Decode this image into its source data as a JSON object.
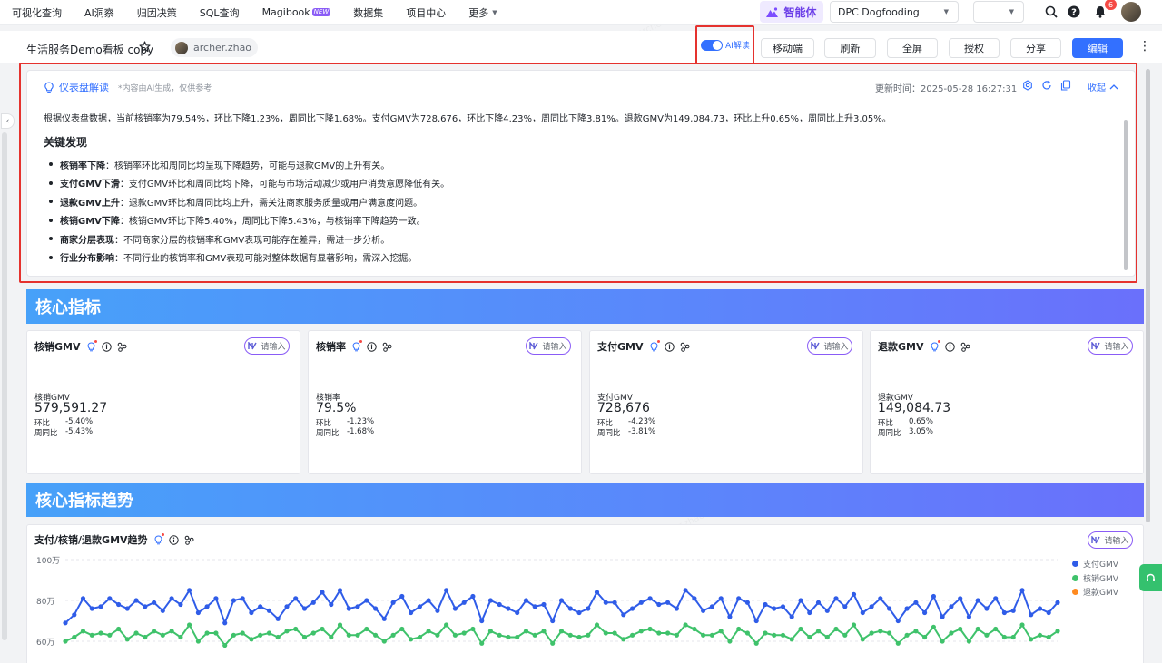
{
  "nav": {
    "items": [
      "可视化查询",
      "AI洞察",
      "归因决策",
      "SQL查询",
      "Magibook",
      "数据集",
      "项目中心",
      "更多"
    ],
    "new_badge": "NEW",
    "agent_label": "智能体",
    "workspace": "DPC Dogfooding",
    "notification_count": "6"
  },
  "dashboard": {
    "title": "生活服务Demo看板 copy",
    "owner": "archer.zhao",
    "ai_toggle_label": "AI解读",
    "buttons": {
      "mobile": "移动端",
      "refresh": "刷新",
      "fullscreen": "全屏",
      "authorize": "授权",
      "share": "分享",
      "edit": "编辑"
    }
  },
  "ai_panel": {
    "title": "仪表盘解读",
    "note": "*内容由AI生成，仅供参考",
    "updated": "更新时间：2025-05-28 16:27:31",
    "collapse_label": "收起",
    "summary": "根据仪表盘数据，当前核销率为79.54%，环比下降1.23%，周同比下降1.68%。支付GMV为728,676，环比下降4.23%，周同比下降3.81%。退款GMV为149,084.73，环比上升0.65%，周同比上升3.05%。",
    "heading": "关键发现",
    "findings": [
      {
        "title": "核销率下降",
        "text": "核销率环比和周同比均呈现下降趋势，可能与退款GMV的上升有关。"
      },
      {
        "title": "支付GMV下滑",
        "text": "支付GMV环比和周同比均下降，可能与市场活动减少或用户消费意愿降低有关。"
      },
      {
        "title": "退款GMV上升",
        "text": "退款GMV环比和周同比均上升，需关注商家服务质量或用户满意度问题。"
      },
      {
        "title": "核销GMV下降",
        "text": "核销GMV环比下降5.40%，周同比下降5.43%，与核销率下降趋势一致。"
      },
      {
        "title": "商家分层表现",
        "text": "不同商家分层的核销率和GMV表现可能存在差异，需进一步分析。"
      },
      {
        "title": "行业分布影响",
        "text": "不同行业的核销率和GMV表现可能对整体数据有显著影响，需深入挖掘。"
      }
    ]
  },
  "sections": {
    "core_metrics": "核心指标",
    "core_trend": "核心指标趋势"
  },
  "ask_label": "请输入",
  "kpis": [
    {
      "title": "核销GMV",
      "label": "核销GMV",
      "value": "579,591.27",
      "mom_label": "环比",
      "mom": "-5.40%",
      "wow_label": "周同比",
      "wow": "-5.43%"
    },
    {
      "title": "核销率",
      "label": "核销率",
      "value": "79.5%",
      "mom_label": "环比",
      "mom": "-1.23%",
      "wow_label": "周同比",
      "wow": "-1.68%"
    },
    {
      "title": "支付GMV",
      "label": "支付GMV",
      "value": "728,676",
      "mom_label": "环比",
      "mom": "-4.23%",
      "wow_label": "周同比",
      "wow": "-3.81%"
    },
    {
      "title": "退款GMV",
      "label": "退款GMV",
      "value": "149,084.73",
      "mom_label": "环比",
      "mom": "0.65%",
      "wow_label": "周同比",
      "wow": "3.05%"
    }
  ],
  "trend": {
    "title": "支付/核销/退款GMV趋势",
    "y_ticks": [
      "100万",
      "80万",
      "60万"
    ]
  },
  "colors": {
    "primary": "#3370ff",
    "pay": "#2f5ce8",
    "verify": "#3fc26b",
    "refund": "#ff8a1f",
    "highlight": "#e5322e"
  },
  "chart_data": {
    "type": "line",
    "ylim": [
      600000,
      1000000
    ],
    "y_ticks": [
      1000000,
      800000,
      600000
    ],
    "series": [
      {
        "name": "支付GMV",
        "values": [
          690000,
          730000,
          810000,
          760000,
          770000,
          810000,
          780000,
          760000,
          800000,
          770000,
          790000,
          750000,
          810000,
          780000,
          850000,
          740000,
          770000,
          810000,
          690000,
          800000,
          810000,
          740000,
          770000,
          750000,
          710000,
          770000,
          810000,
          760000,
          790000,
          840000,
          780000,
          850000,
          760000,
          770000,
          800000,
          760000,
          710000,
          790000,
          820000,
          740000,
          770000,
          800000,
          750000,
          850000,
          760000,
          790000,
          820000,
          700000,
          800000,
          780000,
          760000,
          740000,
          800000,
          770000,
          780000,
          700000,
          800000,
          760000,
          740000,
          760000,
          840000,
          790000,
          790000,
          730000,
          760000,
          790000,
          810000,
          780000,
          790000,
          760000,
          850000,
          810000,
          750000,
          770000,
          810000,
          720000,
          810000,
          790000,
          700000,
          780000,
          760000,
          770000,
          720000,
          800000,
          740000,
          790000,
          750000,
          810000,
          770000,
          830000,
          740000,
          770000,
          810000,
          760000,
          700000,
          760000,
          790000,
          740000,
          820000,
          720000,
          770000,
          810000,
          720000,
          800000,
          760000,
          810000,
          740000,
          750000,
          850000,
          730000,
          760000,
          740000,
          790000
        ]
      },
      {
        "name": "核销GMV",
        "values": [
          600000,
          620000,
          650000,
          630000,
          640000,
          630000,
          660000,
          610000,
          640000,
          620000,
          650000,
          630000,
          650000,
          620000,
          680000,
          600000,
          640000,
          640000,
          580000,
          630000,
          640000,
          610000,
          630000,
          640000,
          620000,
          650000,
          660000,
          620000,
          640000,
          660000,
          620000,
          680000,
          630000,
          630000,
          660000,
          630000,
          600000,
          630000,
          660000,
          610000,
          620000,
          650000,
          630000,
          680000,
          630000,
          640000,
          660000,
          590000,
          650000,
          630000,
          620000,
          620000,
          650000,
          630000,
          650000,
          590000,
          650000,
          630000,
          620000,
          630000,
          680000,
          640000,
          640000,
          610000,
          630000,
          650000,
          660000,
          640000,
          640000,
          630000,
          680000,
          660000,
          630000,
          630000,
          650000,
          600000,
          660000,
          640000,
          590000,
          640000,
          630000,
          630000,
          610000,
          660000,
          620000,
          650000,
          620000,
          660000,
          630000,
          680000,
          610000,
          640000,
          650000,
          640000,
          590000,
          630000,
          650000,
          620000,
          670000,
          600000,
          640000,
          660000,
          600000,
          660000,
          630000,
          660000,
          620000,
          620000,
          680000,
          610000,
          630000,
          620000,
          650000
        ]
      },
      {
        "name": "退款GMV",
        "values": []
      }
    ]
  }
}
